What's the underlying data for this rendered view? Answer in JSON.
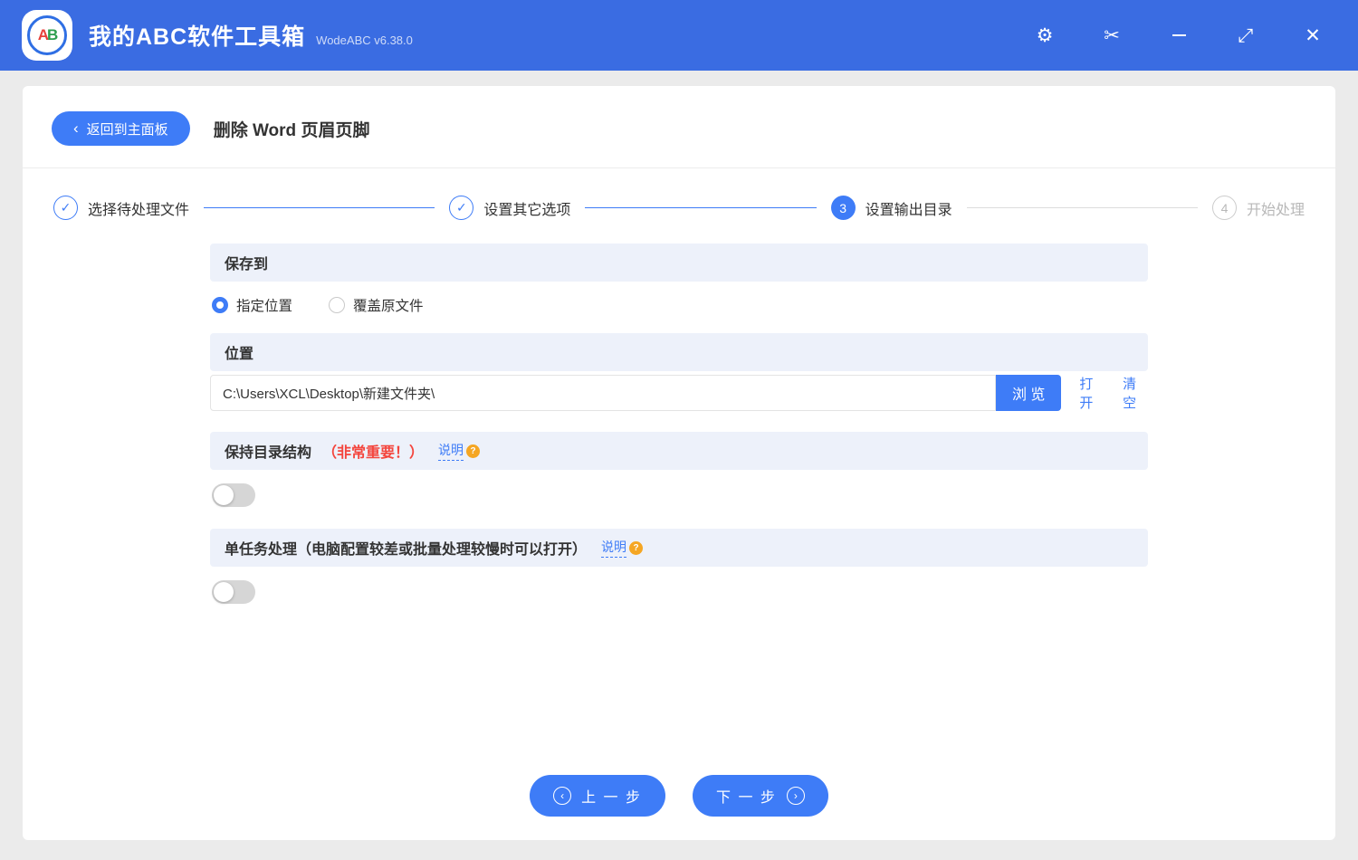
{
  "titlebar": {
    "logo_letter_a": "A",
    "logo_letter_b": "B",
    "title": "我的ABC软件工具箱",
    "version": "WodeABC v6.38.0"
  },
  "header": {
    "back_label": "返回到主面板",
    "back_chevron": "‹",
    "page_title": "删除 Word 页眉页脚"
  },
  "stepper": {
    "steps": [
      {
        "label": "选择待处理文件",
        "mark": "✓",
        "state": "done"
      },
      {
        "label": "设置其它选项",
        "mark": "✓",
        "state": "done"
      },
      {
        "label": "设置输出目录",
        "mark": "3",
        "state": "active"
      },
      {
        "label": "开始处理",
        "mark": "4",
        "state": "pending"
      }
    ]
  },
  "save_to": {
    "title": "保存到",
    "option_specified": "指定位置",
    "option_overwrite": "覆盖原文件"
  },
  "location": {
    "title": "位置",
    "path": "C:\\Users\\XCL\\Desktop\\新建文件夹\\",
    "browse_label": "浏 览",
    "open_label": "打开",
    "clear_label": "清空"
  },
  "keep_structure": {
    "title": "保持目录结构",
    "important": "（非常重要！）",
    "help_label": "说明",
    "help_mark": "?"
  },
  "single_task": {
    "title": "单任务处理（电脑配置较差或批量处理较慢时可以打开）",
    "help_label": "说明",
    "help_mark": "?"
  },
  "footer": {
    "prev_label": "上 一 步",
    "next_label": "下 一 步",
    "prev_arrow": "‹",
    "next_arrow": "›"
  },
  "icons": {
    "gear": "⚙",
    "scissors": "✂",
    "close": "✕",
    "expand": "⤢"
  },
  "colors": {
    "titlebar_blue": "#3a6ce2",
    "accent_blue": "#3e7cf7",
    "section_bg": "#edf1fa",
    "important_red": "#f4453d",
    "help_orange": "#f5a623"
  }
}
